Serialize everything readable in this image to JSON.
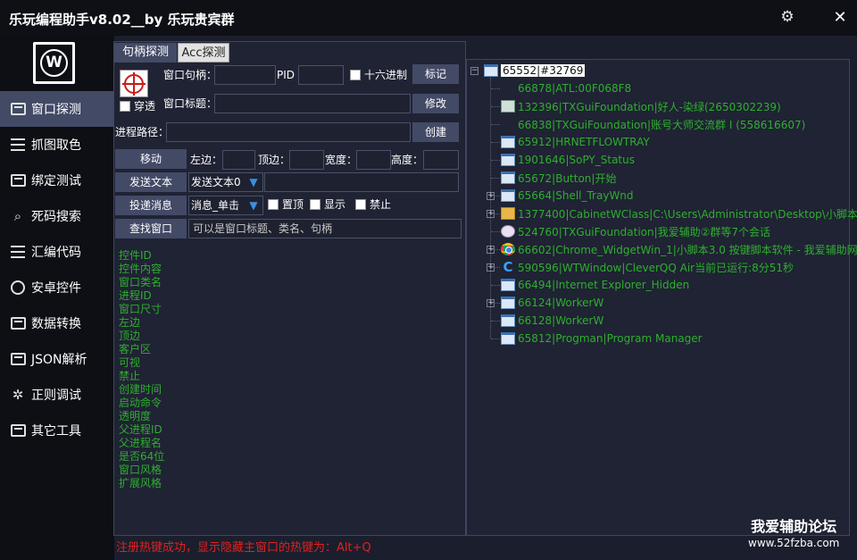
{
  "window": {
    "title": "乐玩编程助手v8.02__by 乐玩贵宾群"
  },
  "titlebar": {
    "settings_icon": "gear-icon",
    "close_glyph": "✕"
  },
  "sidebar": {
    "logo_letter": "W",
    "items": [
      {
        "label": "窗口探测",
        "icon": "window-icon",
        "active": true
      },
      {
        "label": "抓图取色",
        "icon": "film-icon"
      },
      {
        "label": "绑定测试",
        "icon": "bind-icon"
      },
      {
        "label": "死码搜索",
        "icon": "search-icon"
      },
      {
        "label": "汇编代码",
        "icon": "code-icon"
      },
      {
        "label": "安卓控件",
        "icon": "android-icon"
      },
      {
        "label": "数据转换",
        "icon": "lock-icon"
      },
      {
        "label": "JSON解析",
        "icon": "json-icon"
      },
      {
        "label": "正则调试",
        "icon": "regex-icon"
      },
      {
        "label": "其它工具",
        "icon": "toolbox-icon"
      }
    ]
  },
  "tabs": [
    "句柄探测",
    "Acc探测"
  ],
  "form": {
    "handle_label": "窗口句柄：",
    "handle_value": "",
    "pid_label": "PID",
    "pid_value": "",
    "hex_label": "十六进制",
    "mark_button": "标记",
    "pass_label": "穿透",
    "title_label": "窗口标题：",
    "title_value": "",
    "modify_button": "修改",
    "path_label": "进程路径：",
    "path_value": "",
    "create_button": "创建",
    "move_button": "移动",
    "left_label": "左边：",
    "top_label": "顶边：",
    "width_label": "宽度：",
    "height_label": "高度：",
    "send_text_button": "发送文本",
    "send_text_select": "发送文本0",
    "post_msg_button": "投递消息",
    "msg_select": "消息_单击",
    "topmost_label": "置顶",
    "show_label": "显示",
    "disable_label": "禁止",
    "find_button": "查找窗口",
    "find_placeholder": "可以是窗口标题、类名、句柄"
  },
  "properties": [
    "控件ID",
    "控件内容",
    "窗口类名",
    "进程ID",
    "窗口尺寸",
    "左边",
    "顶边",
    "客户区",
    "可视",
    "禁止",
    "创建时间",
    "启动命令",
    "透明度",
    "父进程ID",
    "父进程名",
    "是否64位",
    "窗口风格",
    "扩展风格"
  ],
  "tree": [
    {
      "text": "65552|#32769",
      "icon": "window",
      "root": true,
      "expander": "−"
    },
    {
      "text": "66878|ATL:00F068F8",
      "icon": ""
    },
    {
      "text": "132396|TXGuiFoundation|好人-染绿(2650302239)",
      "icon": "tray"
    },
    {
      "text": "66838|TXGuiFoundation|账号大师交流群 I (558616607)",
      "icon": ""
    },
    {
      "text": "65912|HRNETFLOWTRAY",
      "icon": "window"
    },
    {
      "text": "1901646|SoPY_Status",
      "icon": "window"
    },
    {
      "text": "65672|Button|开始",
      "icon": "window"
    },
    {
      "text": "65664|Shell_TrayWnd",
      "icon": "window",
      "expander": "+"
    },
    {
      "text": "1377400|CabinetWClass|C:\\Users\\Administrator\\Desktop\\小脚本",
      "icon": "folder",
      "expander": "+"
    },
    {
      "text": "524760|TXGuiFoundation|我爱辅助②群等7个会话",
      "icon": "avatar"
    },
    {
      "text": "66602|Chrome_WidgetWin_1|小脚本3.0 按键脚本软件 - 我爱辅助网",
      "icon": "chrome",
      "expander": "+"
    },
    {
      "text": "590596|WTWindow|CleverQQ Air当前已运行:8分51秒",
      "icon": "cq",
      "expander": "+"
    },
    {
      "text": "66494|Internet Explorer_Hidden",
      "icon": "window"
    },
    {
      "text": "66124|WorkerW",
      "icon": "window",
      "expander": "+"
    },
    {
      "text": "66128|WorkerW",
      "icon": "window"
    },
    {
      "text": "65812|Progman|Program Manager",
      "icon": "window"
    }
  ],
  "status": {
    "text": "注册热键成功，显示隐藏主窗口的热键为：Alt+Q"
  },
  "watermark": {
    "line1": "我爱辅助论坛",
    "line2": "www.52fzba.com"
  },
  "colors": {
    "accent": "#434a66",
    "green_text": "#2fae2f",
    "status_red": "#e02020",
    "bg": "#1b1e2c"
  }
}
